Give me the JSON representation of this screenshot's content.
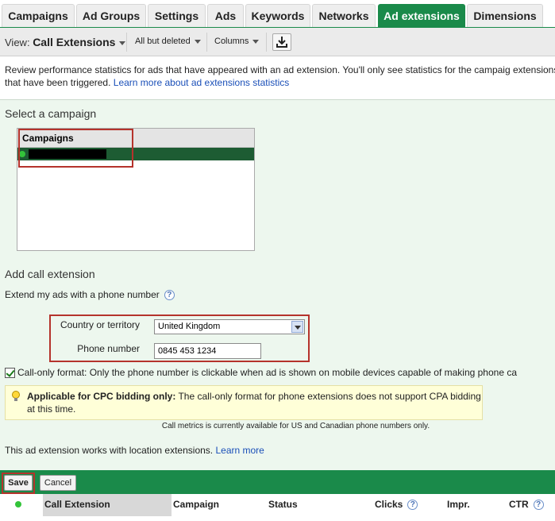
{
  "tabs": [
    {
      "label": "Campaigns",
      "active": false
    },
    {
      "label": "Ad Groups",
      "active": false
    },
    {
      "label": "Settings",
      "active": false
    },
    {
      "label": "Ads",
      "active": false
    },
    {
      "label": "Keywords",
      "active": false
    },
    {
      "label": "Networks",
      "active": false
    },
    {
      "label": "Ad extensions",
      "active": true
    },
    {
      "label": "Dimensions",
      "active": false
    }
  ],
  "toolbar": {
    "view_prefix": "View:",
    "view_value": "Call Extensions",
    "filter_label": "All but deleted",
    "columns_label": "Columns",
    "download_icon": "download-icon"
  },
  "info": {
    "text": "Review performance statistics for ads that have appeared with an ad extension. You'll only see statistics for the campaig extensions that have been triggered.",
    "link": "Learn more about ad extensions statistics"
  },
  "campaign_select": {
    "title": "Select a campaign",
    "column_header": "Campaigns"
  },
  "call_extension": {
    "title": "Add call extension",
    "subtitle": "Extend my ads with a phone number",
    "country_label": "Country or territory",
    "country_value": "United Kingdom",
    "phone_label": "Phone number",
    "phone_value": "0845 453 1234",
    "call_only_label": "Call-only format: Only the phone number is clickable when ad is shown on mobile devices capable of making phone ca",
    "call_only_checked": true
  },
  "tip": {
    "bold": "Applicable for CPC bidding only:",
    "text": "The call-only format for phone extensions does not support CPA bidding at this time."
  },
  "metrics_note": "Call metrics is currently available for US and Canadian phone numbers only.",
  "location_note": {
    "text": "This ad extension works with location extensions.",
    "link": "Learn more"
  },
  "buttons": {
    "save": "Save",
    "cancel": "Cancel"
  },
  "table_headers": {
    "call_extension": "Call Extension",
    "campaign": "Campaign",
    "status": "Status",
    "clicks": "Clicks",
    "impr": "Impr.",
    "ctr": "CTR"
  },
  "colors": {
    "brand_green": "#1a8a4a",
    "status_green": "#33c43a",
    "highlight_red": "#b5332c"
  }
}
